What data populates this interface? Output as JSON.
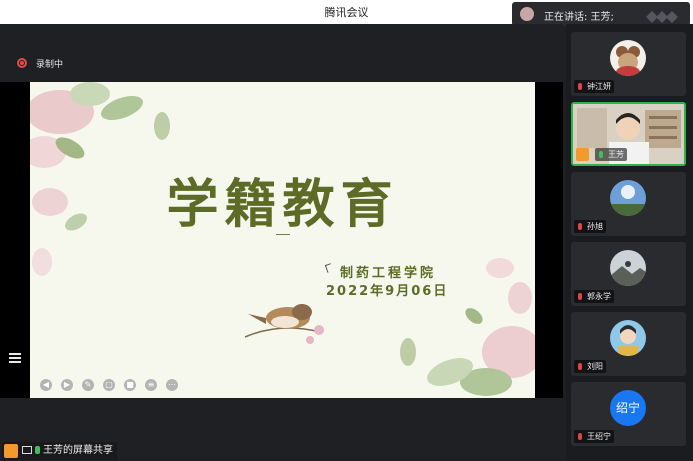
{
  "window": {
    "title": "腾讯会议"
  },
  "speaking": {
    "label": "正在讲话: 王芳;"
  },
  "recording": {
    "label": "录制中"
  },
  "slide": {
    "title": "学籍教育",
    "subtitle": "制药工程学院",
    "date": "2022年9月06日"
  },
  "share": {
    "label": "王芳的屏幕共享"
  },
  "participants": [
    {
      "name": "钟江妍",
      "mic": "muted",
      "avatar": "bear-avatar"
    },
    {
      "name": "王芳",
      "mic": "on",
      "video": true
    },
    {
      "name": "孙旭",
      "mic": "muted",
      "avatar": "sky-avatar"
    },
    {
      "name": "郭永学",
      "mic": "muted",
      "avatar": "landscape-avatar"
    },
    {
      "name": "刘阳",
      "mic": "muted",
      "avatar": "person-avatar"
    },
    {
      "name": "王绍宁",
      "mic": "muted",
      "avatar_text": "绍宁"
    }
  ],
  "colors": {
    "accent_green": "#2fb24c",
    "slide_title": "#5d6b27",
    "avatar_blue": "#1977f2",
    "record_red": "#e14b4b"
  }
}
